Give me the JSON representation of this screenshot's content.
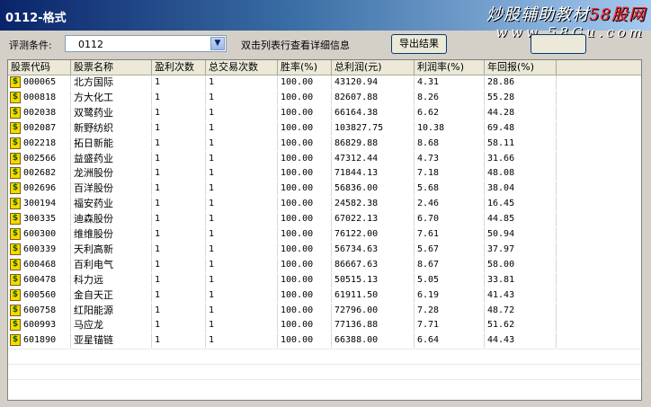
{
  "window": {
    "title": "0112-格式"
  },
  "watermark": {
    "line1_prefix": "炒股辅助教材",
    "line1_brand": "58股网",
    "line2": "www.58Gu.com"
  },
  "toolbar": {
    "condition_label": "评测条件:",
    "condition_value": "0112",
    "hint": "双击列表行查看详细信息",
    "export_label": "导出结果"
  },
  "table": {
    "columns": [
      "股票代码",
      "股票名称",
      "盈利次数",
      "总交易次数",
      "胜率(%)",
      "总利润(元)",
      "利润率(%)",
      "年回报(%)"
    ],
    "rows": [
      [
        "000065",
        "北方国际",
        "1",
        "1",
        "100.00",
        "43120.94",
        "4.31",
        "28.86"
      ],
      [
        "000818",
        "方大化工",
        "1",
        "1",
        "100.00",
        "82607.88",
        "8.26",
        "55.28"
      ],
      [
        "002038",
        "双鹭药业",
        "1",
        "1",
        "100.00",
        "66164.38",
        "6.62",
        "44.28"
      ],
      [
        "002087",
        "新野纺织",
        "1",
        "1",
        "100.00",
        "103827.75",
        "10.38",
        "69.48"
      ],
      [
        "002218",
        "拓日新能",
        "1",
        "1",
        "100.00",
        "86829.88",
        "8.68",
        "58.11"
      ],
      [
        "002566",
        "益盛药业",
        "1",
        "1",
        "100.00",
        "47312.44",
        "4.73",
        "31.66"
      ],
      [
        "002682",
        "龙洲股份",
        "1",
        "1",
        "100.00",
        "71844.13",
        "7.18",
        "48.08"
      ],
      [
        "002696",
        "百洋股份",
        "1",
        "1",
        "100.00",
        "56836.00",
        "5.68",
        "38.04"
      ],
      [
        "300194",
        "福安药业",
        "1",
        "1",
        "100.00",
        "24582.38",
        "2.46",
        "16.45"
      ],
      [
        "300335",
        "迪森股份",
        "1",
        "1",
        "100.00",
        "67022.13",
        "6.70",
        "44.85"
      ],
      [
        "600300",
        "维维股份",
        "1",
        "1",
        "100.00",
        "76122.00",
        "7.61",
        "50.94"
      ],
      [
        "600339",
        "天利高新",
        "1",
        "1",
        "100.00",
        "56734.63",
        "5.67",
        "37.97"
      ],
      [
        "600468",
        "百利电气",
        "1",
        "1",
        "100.00",
        "86667.63",
        "8.67",
        "58.00"
      ],
      [
        "600478",
        "科力远",
        "1",
        "1",
        "100.00",
        "50515.13",
        "5.05",
        "33.81"
      ],
      [
        "600560",
        "金自天正",
        "1",
        "1",
        "100.00",
        "61911.50",
        "6.19",
        "41.43"
      ],
      [
        "600758",
        "红阳能源",
        "1",
        "1",
        "100.00",
        "72796.00",
        "7.28",
        "48.72"
      ],
      [
        "600993",
        "马应龙",
        "1",
        "1",
        "100.00",
        "77136.88",
        "7.71",
        "51.62"
      ],
      [
        "601890",
        "亚星锚链",
        "1",
        "1",
        "100.00",
        "66388.00",
        "6.64",
        "44.43"
      ]
    ]
  }
}
